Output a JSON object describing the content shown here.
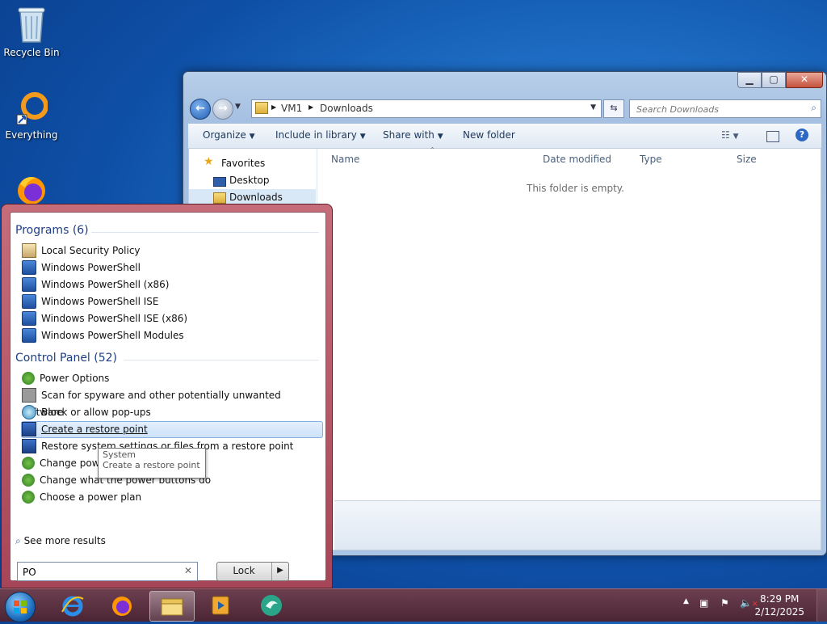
{
  "desktop": {
    "icons": [
      {
        "label": "Recycle Bin"
      },
      {
        "label": "Everything"
      }
    ]
  },
  "explorer": {
    "breadcrumb": [
      "VM1",
      "Downloads"
    ],
    "search_placeholder": "Search Downloads",
    "toolbar": {
      "organize": "Organize",
      "include_in_library": "Include in library",
      "share_with": "Share with",
      "new_folder": "New folder"
    },
    "nav": {
      "favorites": "Favorites",
      "desktop": "Desktop",
      "downloads": "Downloads"
    },
    "columns": [
      "Name",
      "Date modified",
      "Type",
      "Size"
    ],
    "empty_message": "This folder is empty."
  },
  "start_menu": {
    "programs_header": "Programs (6)",
    "programs": [
      "Local Security Policy",
      "Windows PowerShell",
      "Windows PowerShell (x86)",
      "Windows PowerShell ISE",
      "Windows PowerShell ISE (x86)",
      "Windows PowerShell Modules"
    ],
    "control_panel_header": "Control Panel (52)",
    "control_panel": [
      "Power Options",
      "Scan for spyware and other potentially unwanted software",
      "Block or allow pop-ups",
      "Create a restore point",
      "Restore system settings or files from a restore point",
      "Change power-saving settings",
      "Change what the power buttons do",
      "Choose a power plan"
    ],
    "tooltip": {
      "title": "System",
      "text": "Create a restore point"
    },
    "see_more": "See more results",
    "search_value": "PO",
    "lock_label": "Lock"
  },
  "taskbar": {
    "time": "8:29 PM",
    "date": "2/12/2025"
  }
}
